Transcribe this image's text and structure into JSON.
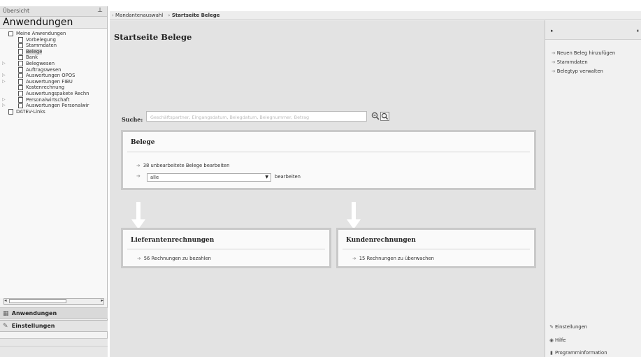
{
  "sidebar": {
    "header_label": "Übersicht",
    "pin_icon": "pin-icon",
    "title": "Anwendungen",
    "tree": [
      {
        "label": "Meine Anwendungen",
        "indent": 0,
        "twisty": "",
        "selected": false
      },
      {
        "label": "Vorbelegung",
        "indent": 1,
        "twisty": "",
        "selected": false
      },
      {
        "label": "Stammdaten",
        "indent": 1,
        "twisty": "",
        "selected": false
      },
      {
        "label": "Belege",
        "indent": 1,
        "twisty": "",
        "selected": true
      },
      {
        "label": "Bank",
        "indent": 1,
        "twisty": "",
        "selected": false
      },
      {
        "label": "Belegwesen",
        "indent": 1,
        "twisty": "▷",
        "selected": false
      },
      {
        "label": "Auftragswesen",
        "indent": 1,
        "twisty": "",
        "selected": false
      },
      {
        "label": "Auswertungen OPOS",
        "indent": 1,
        "twisty": "▷",
        "selected": false
      },
      {
        "label": "Auswertungen FIBU",
        "indent": 1,
        "twisty": "▷",
        "selected": false
      },
      {
        "label": "Kostenrechnung",
        "indent": 1,
        "twisty": "",
        "selected": false
      },
      {
        "label": "Auswertungspakete Rechn",
        "indent": 1,
        "twisty": "",
        "selected": false
      },
      {
        "label": "Personalwirtschaft",
        "indent": 1,
        "twisty": "▷",
        "selected": false
      },
      {
        "label": "Auswertungen Personalwir",
        "indent": 1,
        "twisty": "▷",
        "selected": false
      },
      {
        "label": "DATEV-Links",
        "indent": 0,
        "twisty": "",
        "selected": false
      }
    ],
    "scroll_left": "◂",
    "scroll_right": "▸",
    "dots": "........",
    "panels": [
      {
        "label": "Anwendungen",
        "icon": "grid-icon",
        "glyph": "▦"
      },
      {
        "label": "Einstellungen",
        "icon": "wrench-icon",
        "glyph": "✎"
      }
    ]
  },
  "topbar": {
    "crumbs": [
      "Mandantenauswahl",
      "Startseite Belege"
    ],
    "arrow": "›"
  },
  "main": {
    "title": "Startseite Belege",
    "search": {
      "label": "Suche:",
      "placeholder": "Geschäftspartner, Eingangsdatum, Belegdatum, Belegnummer, Betrag"
    },
    "belege": {
      "title": "Belege",
      "link": "38 unbearbeitete Belege bearbeiten",
      "select_value": "alle",
      "select_after": "bearbeiten"
    },
    "lieferanten": {
      "title": "Lieferantenrechnungen",
      "link": "56 Rechnungen zu bezahlen"
    },
    "kunden": {
      "title": "Kundenrechnungen",
      "link": "15 Rechnungen zu überwachen"
    }
  },
  "rpanel": {
    "head_left": "▸",
    "head_right": "⏸",
    "links": [
      "Neuen Beleg hinzufügen",
      "Stammdaten",
      "Belegtyp verwalten"
    ],
    "bottom": [
      {
        "label": "Einstellungen",
        "icon": "wrench-icon",
        "glyph": "✎"
      },
      {
        "label": "Hilfe",
        "icon": "help-icon",
        "glyph": "◉"
      },
      {
        "label": "Programminformation",
        "icon": "info-icon",
        "glyph": "▮"
      }
    ]
  }
}
